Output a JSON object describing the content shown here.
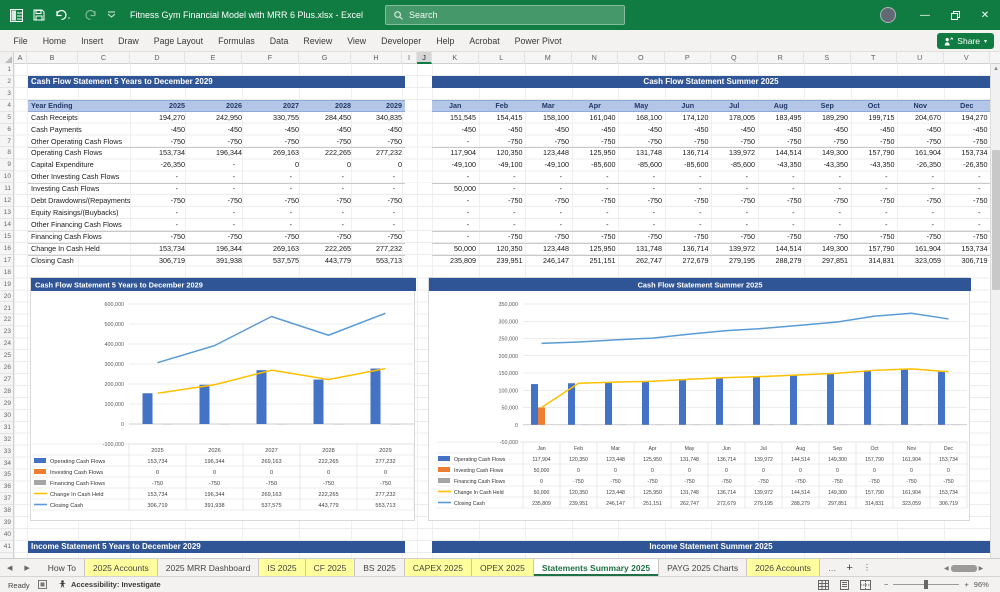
{
  "title_bar": {
    "title": "Fitness Gym Financial Model with MRR 6 Plus.xlsx  -  Excel",
    "search_placeholder": "Search"
  },
  "ribbon": {
    "tabs": [
      "File",
      "Home",
      "Insert",
      "Draw",
      "Page Layout",
      "Formulas",
      "Data",
      "Review",
      "View",
      "Developer",
      "Help",
      "Acrobat",
      "Power Pivot"
    ],
    "share_label": "Share"
  },
  "grid": {
    "columns": [
      "A",
      "B",
      "C",
      "D",
      "E",
      "F",
      "G",
      "H",
      "I",
      "J",
      "K",
      "L",
      "M",
      "N",
      "O",
      "P",
      "Q",
      "R",
      "S",
      "T",
      "U",
      "V"
    ],
    "selected_column": "J",
    "row_count": 41
  },
  "sheet": {
    "headers": {
      "cashflow_left": "Cash Flow Statement 5 Years to December 2029",
      "cashflow_right": "Cash Flow Statement Summer 2025",
      "income_left": "Income Statement 5 Years to December 2029",
      "income_right": "Income Statement Summer 2025"
    },
    "table": {
      "row_label_header": "Year Ending",
      "year_columns": [
        "2025",
        "2026",
        "2027",
        "2028",
        "2029"
      ],
      "month_columns": [
        "Jan",
        "Feb",
        "Mar",
        "Apr",
        "May",
        "Jun",
        "Jul",
        "Aug",
        "Sep",
        "Oct",
        "Nov",
        "Dec"
      ],
      "rows": [
        {
          "label": "Cash Receipts",
          "years": [
            "194,270",
            "242,950",
            "330,755",
            "284,450",
            "340,835"
          ],
          "months": [
            "151,545",
            "154,415",
            "158,100",
            "161,040",
            "168,100",
            "174,120",
            "178,005",
            "183,495",
            "189,290",
            "199,715",
            "204,670",
            "194,270"
          ],
          "rule": false
        },
        {
          "label": "Cash Payments",
          "years": [
            "-450",
            "-450",
            "-450",
            "-450",
            "-450"
          ],
          "months": [
            "-450",
            "-450",
            "-450",
            "-450",
            "-450",
            "-450",
            "-450",
            "-450",
            "-450",
            "-450",
            "-450",
            "-450"
          ],
          "rule": false
        },
        {
          "label": "Other Operating Cash Flows",
          "years": [
            "-750",
            "-750",
            "-750",
            "-750",
            "-750"
          ],
          "months": [
            "-",
            "-750",
            "-750",
            "-750",
            "-750",
            "-750",
            "-750",
            "-750",
            "-750",
            "-750",
            "-750",
            "-750"
          ],
          "rule": false
        },
        {
          "label": "Operating Cash Flows",
          "years": [
            "153,734",
            "196,344",
            "269,163",
            "222,265",
            "277,232"
          ],
          "months": [
            "117,904",
            "120,350",
            "123,448",
            "125,950",
            "131,748",
            "136,714",
            "139,972",
            "144,514",
            "149,300",
            "157,790",
            "161,904",
            "153,734"
          ],
          "rule": true
        },
        {
          "label": "Capital Expenditure",
          "years": [
            "-26,350",
            "-",
            "0",
            "0",
            "0"
          ],
          "months": [
            "-49,100",
            "-49,100",
            "-49,100",
            "-85,600",
            "-85,600",
            "-85,600",
            "-85,600",
            "-43,350",
            "-43,350",
            "-43,350",
            "-26,350",
            "-26,350"
          ],
          "rule": false
        },
        {
          "label": "Other Investing Cash Flows",
          "years": [
            "-",
            "-",
            "-",
            "-",
            "-"
          ],
          "months": [
            "-",
            "-",
            "-",
            "-",
            "-",
            "-",
            "-",
            "-",
            "-",
            "-",
            "-",
            "-"
          ],
          "rule": false
        },
        {
          "label": "Investing Cash Flows",
          "years": [
            "-",
            "-",
            "-",
            "-",
            "-"
          ],
          "months": [
            "50,000",
            "-",
            "-",
            "-",
            "-",
            "-",
            "-",
            "-",
            "-",
            "-",
            "-",
            "-"
          ],
          "rule": true
        },
        {
          "label": "Debt Drawdowns/(Repayments",
          "years": [
            "-750",
            "-750",
            "-750",
            "-750",
            "-750"
          ],
          "months": [
            "-",
            "-750",
            "-750",
            "-750",
            "-750",
            "-750",
            "-750",
            "-750",
            "-750",
            "-750",
            "-750",
            "-750"
          ],
          "rule": false
        },
        {
          "label": "Equity Raisings/(Buybacks)",
          "years": [
            "-",
            "-",
            "-",
            "-",
            "-"
          ],
          "months": [
            "-",
            "-",
            "-",
            "-",
            "-",
            "-",
            "-",
            "-",
            "-",
            "-",
            "-",
            "-"
          ],
          "rule": false
        },
        {
          "label": "Other Financing Cash Flows",
          "years": [
            "-",
            "-",
            "-",
            "-",
            "-"
          ],
          "months": [
            "-",
            "-",
            "-",
            "-",
            "-",
            "-",
            "-",
            "-",
            "-",
            "-",
            "-",
            "-"
          ],
          "rule": false
        },
        {
          "label": "Financing Cash Flows",
          "years": [
            "-750",
            "-750",
            "-750",
            "-750",
            "-750"
          ],
          "months": [
            "-",
            "-750",
            "-750",
            "-750",
            "-750",
            "-750",
            "-750",
            "-750",
            "-750",
            "-750",
            "-750",
            "-750"
          ],
          "rule": true
        },
        {
          "label": "Change In Cash Held",
          "years": [
            "153,734",
            "196,344",
            "269,163",
            "222,265",
            "277,232"
          ],
          "months": [
            "50,000",
            "120,350",
            "123,448",
            "125,950",
            "131,748",
            "136,714",
            "139,972",
            "144,514",
            "149,300",
            "157,790",
            "161,904",
            "153,734"
          ],
          "rule": true
        },
        {
          "label": "Closing Cash",
          "years": [
            "306,719",
            "391,938",
            "537,575",
            "443,779",
            "553,713"
          ],
          "months": [
            "235,809",
            "239,951",
            "246,147",
            "251,151",
            "262,747",
            "272,679",
            "279,195",
            "288,279",
            "297,851",
            "314,831",
            "323,059",
            "306,719"
          ],
          "rule": true
        }
      ]
    }
  },
  "chart_data": [
    {
      "type": "combo",
      "title": "Cash Flow Statement 5 Years to December 2029",
      "categories": [
        "2025",
        "2026",
        "2027",
        "2028",
        "2029"
      ],
      "series": [
        {
          "name": "Operating Cash Flows",
          "chart_type": "bar",
          "color": "#4472C4",
          "values": [
            153734,
            196344,
            269163,
            222265,
            277232
          ]
        },
        {
          "name": "Investing Cash Flows",
          "chart_type": "bar",
          "color": "#ED7D31",
          "values": [
            0,
            0,
            0,
            0,
            0
          ]
        },
        {
          "name": "Financing Cash Flows",
          "chart_type": "bar",
          "color": "#A5A5A5",
          "values": [
            -750,
            -750,
            -750,
            -750,
            -750
          ]
        },
        {
          "name": "Change In Cash Held",
          "chart_type": "line",
          "color": "#FFC000",
          "values": [
            153734,
            196344,
            269163,
            222265,
            277232
          ]
        },
        {
          "name": "Closing Cash",
          "chart_type": "line",
          "color": "#5B9BD5",
          "values": [
            306719,
            391938,
            537575,
            443779,
            553713
          ]
        }
      ],
      "ylim": [
        -100000,
        600000
      ],
      "ystep": 100000,
      "grid": true,
      "data_table": true,
      "legend_position": "table-left"
    },
    {
      "type": "combo",
      "title": "Cash Flow Statement Summer 2025",
      "categories": [
        "Jan",
        "Feb",
        "Mar",
        "Apr",
        "May",
        "Jun",
        "Jul",
        "Aug",
        "Sep",
        "Oct",
        "Nov",
        "Dec"
      ],
      "series": [
        {
          "name": "Operating Cash Flows",
          "chart_type": "bar",
          "color": "#4472C4",
          "values": [
            117904,
            120350,
            123448,
            125950,
            131748,
            136714,
            139972,
            144514,
            149300,
            157790,
            161904,
            153734
          ]
        },
        {
          "name": "Investing Cash Flows",
          "chart_type": "bar",
          "color": "#ED7D31",
          "values": [
            50000,
            0,
            0,
            0,
            0,
            0,
            0,
            0,
            0,
            0,
            0,
            0
          ]
        },
        {
          "name": "Financing Cash Flows",
          "chart_type": "bar",
          "color": "#A5A5A5",
          "values": [
            0,
            -750,
            -750,
            -750,
            -750,
            -750,
            -750,
            -750,
            -750,
            -750,
            -750,
            -750
          ]
        },
        {
          "name": "Change In Cash Held",
          "chart_type": "line",
          "color": "#FFC000",
          "values": [
            50000,
            120350,
            123448,
            125950,
            131748,
            136714,
            139972,
            144514,
            149300,
            157790,
            161904,
            153734
          ]
        },
        {
          "name": "Closing Cash",
          "chart_type": "line",
          "color": "#5B9BD5",
          "values": [
            235809,
            239951,
            246147,
            251151,
            262747,
            272679,
            279195,
            288279,
            297851,
            314831,
            323059,
            306719
          ]
        }
      ],
      "ylim": [
        -50000,
        350000
      ],
      "ystep": 50000,
      "grid": true,
      "data_table": true,
      "legend_position": "table-left"
    }
  ],
  "sheet_tabs": {
    "items": [
      {
        "label": "How To",
        "style": "plain"
      },
      {
        "label": "2025 Accounts",
        "style": "yellow"
      },
      {
        "label": "2025 MRR Dashboard",
        "style": "plain"
      },
      {
        "label": "IS 2025",
        "style": "yellow"
      },
      {
        "label": "CF 2025",
        "style": "yellow"
      },
      {
        "label": "BS 2025",
        "style": "plain"
      },
      {
        "label": "CAPEX 2025",
        "style": "yellow"
      },
      {
        "label": "OPEX 2025",
        "style": "yellow"
      },
      {
        "label": "Statements Summary 2025",
        "style": "active"
      },
      {
        "label": "PAYG 2025 Charts",
        "style": "plain"
      },
      {
        "label": "2026 Accounts",
        "style": "yellow"
      }
    ],
    "more_label": "…",
    "add_label": "+",
    "menu_label": "⋮"
  },
  "status_bar": {
    "ready": "Ready",
    "accessibility": "Accessibility: Investigate",
    "zoom_level": "96%"
  },
  "colors": {
    "excel_green": "#107C41",
    "header_blue": "#2F5597",
    "band_blue": "#B4C6E7",
    "tab_yellow": "#FFFF9E",
    "bar_blue": "#4472C4",
    "bar_orange": "#ED7D31",
    "bar_gray": "#A5A5A5",
    "line_yellow": "#FFC000",
    "line_blue": "#5B9BD5"
  }
}
